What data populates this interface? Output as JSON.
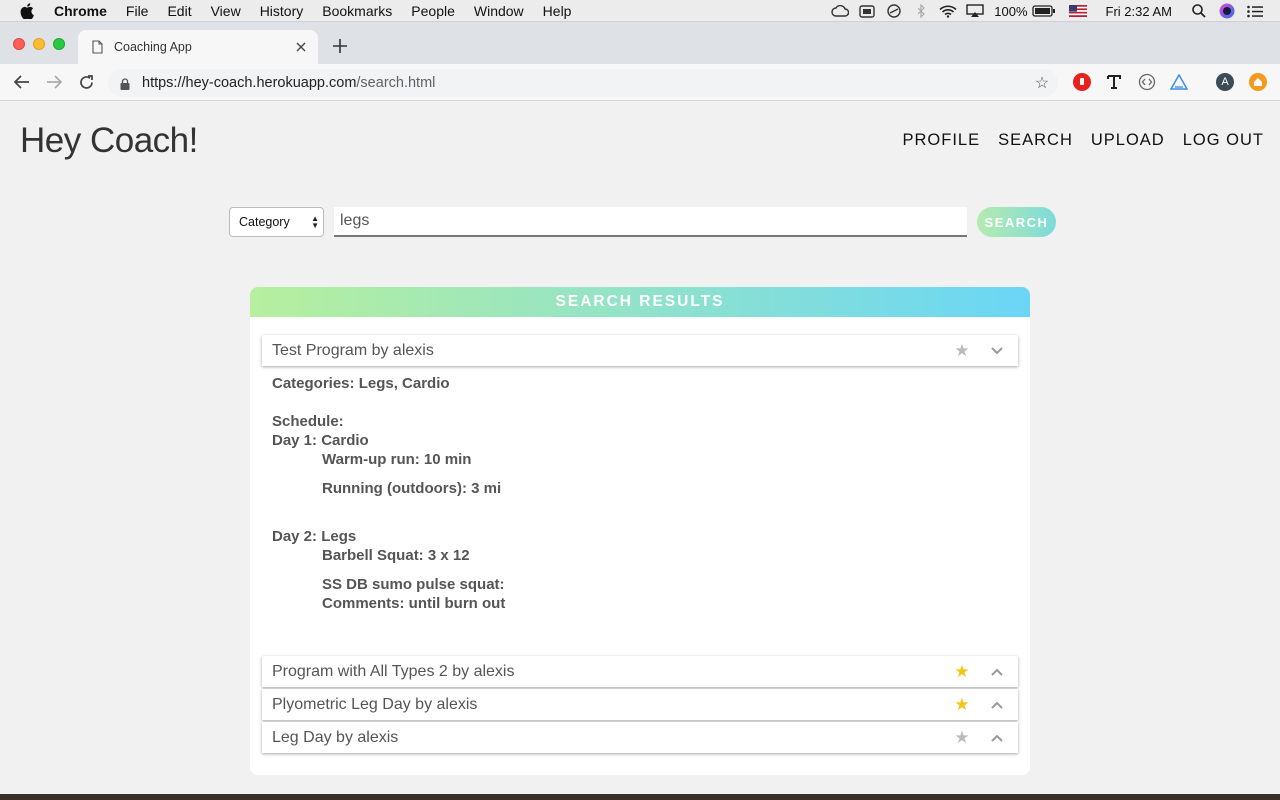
{
  "menubar": {
    "app_name": "Chrome",
    "items": [
      "File",
      "Edit",
      "View",
      "History",
      "Bookmarks",
      "People",
      "Window",
      "Help"
    ],
    "battery": "100%",
    "clock": "Fri 2:32 AM"
  },
  "browser": {
    "tab_title": "Coaching App",
    "url_host": "https://hey-coach.herokuapp.com",
    "url_path": "/search.html",
    "profile_initial": "A"
  },
  "page": {
    "brand": "Hey Coach!",
    "nav": [
      "PROFILE",
      "SEARCH",
      "UPLOAD",
      "LOG OUT"
    ],
    "search": {
      "category_label": "Category",
      "query": "legs",
      "button_label": "SEARCH"
    },
    "results": {
      "header": "SEARCH RESULTS",
      "items": [
        {
          "title": "Test Program by alexis",
          "favorited": false,
          "expanded": true
        },
        {
          "title": "Program with All Types 2 by alexis",
          "favorited": true,
          "expanded": false
        },
        {
          "title": "Plyometric Leg Day by alexis",
          "favorited": true,
          "expanded": false
        },
        {
          "title": "Leg Day by alexis",
          "favorited": false,
          "expanded": false
        }
      ],
      "expanded_details": {
        "categories": "Categories: Legs, Cardio",
        "schedule_label": "Schedule:",
        "days": [
          {
            "heading": "Day 1: Cardio",
            "exercises": [
              "Warm-up run: 10 min",
              "Running (outdoors): 3 mi"
            ]
          },
          {
            "heading": "Day 2: Legs",
            "exercises": [
              "Barbell Squat: 3 x 12",
              "SS DB sumo pulse squat:"
            ],
            "comment": "Comments: until burn out"
          }
        ]
      }
    }
  },
  "colors": {
    "header_gradient_start": "#b7ef9e",
    "header_gradient_end": "#6ad6f6",
    "star_active": "#f5c518",
    "star_inactive": "#bbbbbb"
  }
}
